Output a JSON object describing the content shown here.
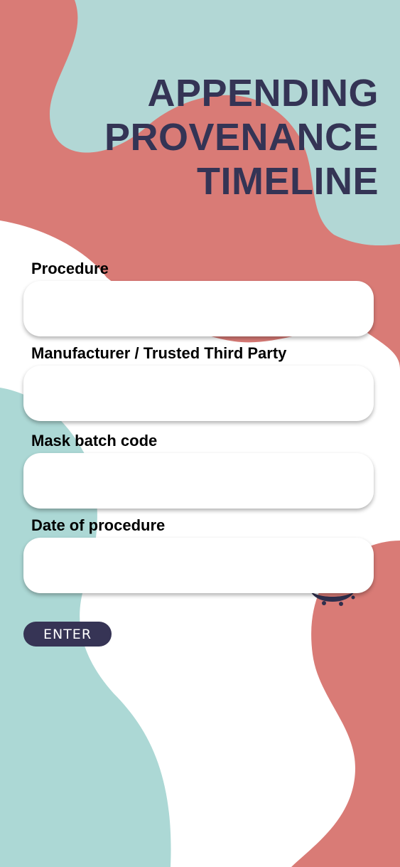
{
  "title": {
    "line1": "APPENDING",
    "line2": "PROVENANCE",
    "line3": "TIMELINE"
  },
  "form": {
    "procedure_label": "Procedure",
    "procedure_value": "",
    "manufacturer_label": "Manufacturer / Trusted Third Party",
    "manufacturer_value": "",
    "batch_label": "Mask batch code",
    "batch_value": "",
    "date_label": "Date of procedure",
    "date_value": ""
  },
  "enter_label": "ENTER",
  "colors": {
    "coral": "#d97b76",
    "teal": "#b0d9d6",
    "navy": "#343455",
    "white": "#ffffff"
  }
}
